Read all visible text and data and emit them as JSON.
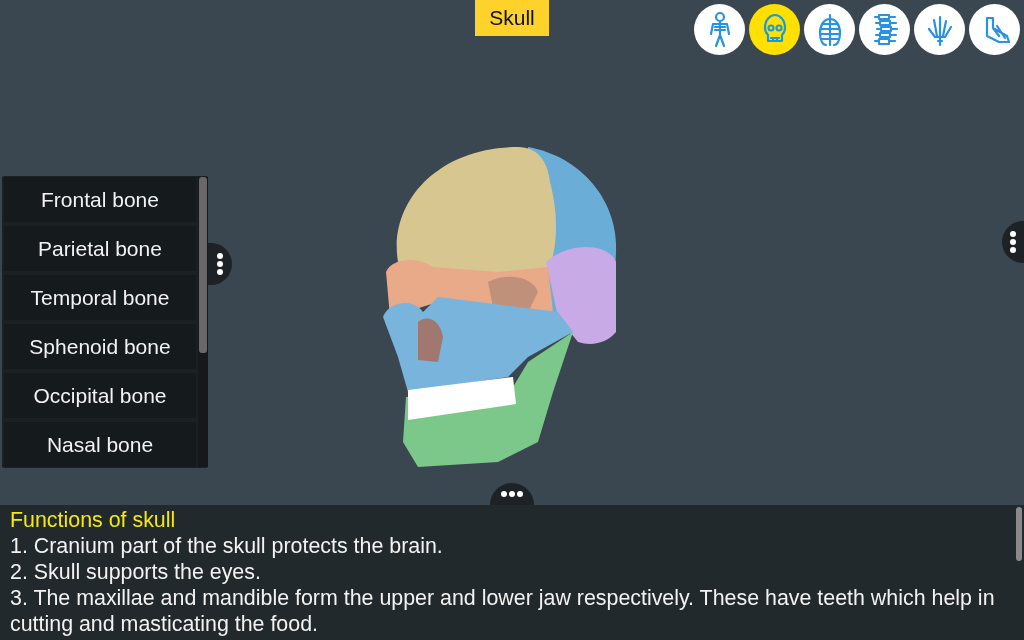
{
  "title": "Skull",
  "regions": [
    {
      "kind": "skeleton",
      "selected": false
    },
    {
      "kind": "skull",
      "selected": true
    },
    {
      "kind": "ribcage",
      "selected": false
    },
    {
      "kind": "spine",
      "selected": false
    },
    {
      "kind": "hand",
      "selected": false
    },
    {
      "kind": "foot",
      "selected": false
    }
  ],
  "bones": [
    {
      "label": "Frontal bone"
    },
    {
      "label": "Parietal bone"
    },
    {
      "label": "Temporal bone"
    },
    {
      "label": "Sphenoid bone"
    },
    {
      "label": "Occipital bone"
    },
    {
      "label": "Nasal bone"
    }
  ],
  "info": {
    "heading": "Functions of skull",
    "lines": [
      "1. Cranium part of the skull protects the brain.",
      "2. Skull supports the eyes.",
      "3. The maxillae and mandible form the upper and lower jaw respectively. These have teeth which help in cutting and masticating the food."
    ]
  }
}
